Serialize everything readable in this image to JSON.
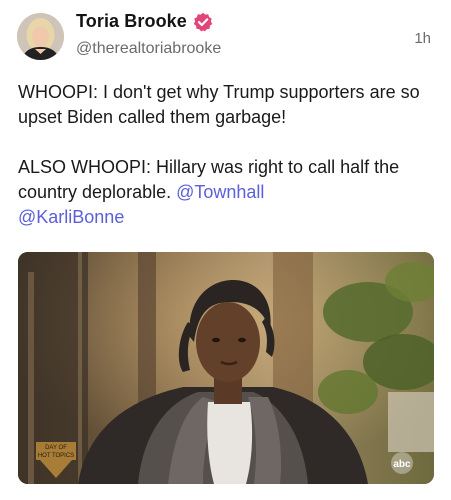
{
  "post": {
    "author": {
      "display_name": "Toria Brooke",
      "handle": "@therealtoriabrooke",
      "verified": true,
      "avatar_icon": "profile-photo"
    },
    "timestamp": "1h",
    "text": {
      "paragraph1": "WHOOPI: I don't get why Trump supporters are so upset Biden called them garbage!",
      "paragraph2_text": "ALSO WHOOPI: Hillary was right to call half the country deplorable. ",
      "mention1": "@Townhall",
      "mention2": "@KarliBonne"
    },
    "media": {
      "type": "video-still",
      "overlay_logo_left_line1": "DAY OF",
      "overlay_logo_left_line2": "HOT TOPICS",
      "overlay_logo_right": "abc"
    }
  },
  "colors": {
    "mention": "#5b5fd9",
    "verified_badge": "#e3447a",
    "secondary_text": "#6b6b6b"
  }
}
